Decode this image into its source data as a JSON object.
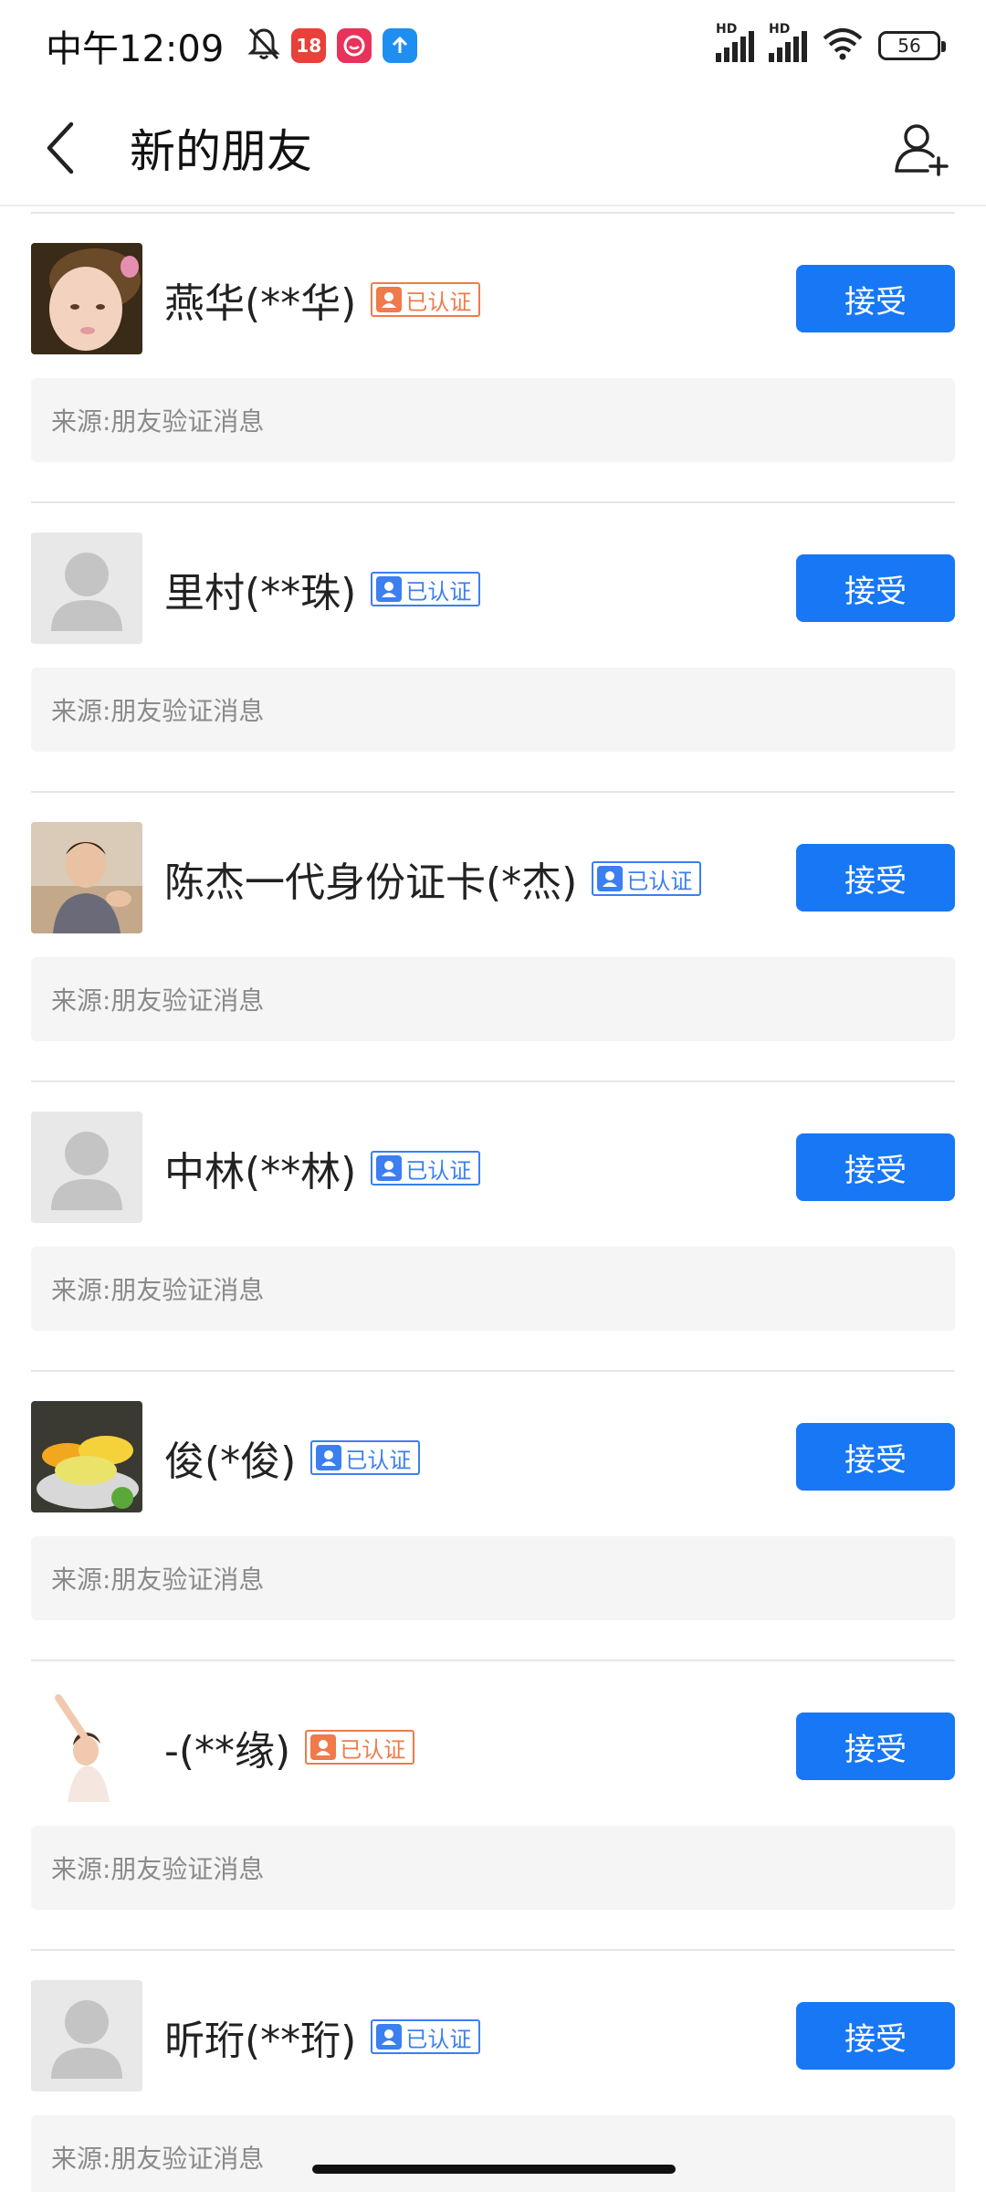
{
  "status_bar": {
    "time": "中午12:09",
    "notif_icons": [
      {
        "icon": "bell-off-icon"
      },
      {
        "icon": "app-icon-red",
        "text": "18",
        "color": "#e8403a"
      },
      {
        "icon": "app-icon-pink",
        "color": "#e8325a"
      },
      {
        "icon": "upload-icon",
        "color": "#1e8ff0"
      }
    ],
    "signal_1_label": "HD",
    "signal_2_label": "HD",
    "battery": "56"
  },
  "nav": {
    "title": "新的朋友",
    "back_icon": "back-chevron-icon",
    "add_icon": "add-friend-icon"
  },
  "colors": {
    "accent": "#1777f5",
    "badge_male": "#3b7ff0",
    "badge_female": "#f07a4a",
    "source_bg": "#f5f5f5"
  },
  "requests": [
    {
      "name": "燕华(**华)",
      "badge": "已认证",
      "badge_type": "female",
      "accept": "接受",
      "source": "来源:朋友验证消息",
      "avatar": "photo-child"
    },
    {
      "name": "里村(**珠)",
      "badge": "已认证",
      "badge_type": "male",
      "accept": "接受",
      "source": "来源:朋友验证消息",
      "avatar": "default"
    },
    {
      "name": "陈杰一代身份证卡(*杰)",
      "badge": "已认证",
      "badge_type": "male",
      "accept": "接受",
      "source": "来源:朋友验证消息",
      "avatar": "photo-man"
    },
    {
      "name": "中林(**林)",
      "badge": "已认证",
      "badge_type": "male",
      "accept": "接受",
      "source": "来源:朋友验证消息",
      "avatar": "default"
    },
    {
      "name": "俊(*俊)",
      "badge": "已认证",
      "badge_type": "male",
      "accept": "接受",
      "source": "来源:朋友验证消息",
      "avatar": "photo-lemon"
    },
    {
      "name": "-(**缘)",
      "badge": "已认证",
      "badge_type": "female",
      "accept": "接受",
      "source": "来源:朋友验证消息",
      "avatar": "photo-dancer"
    },
    {
      "name": "昕珩(**珩)",
      "badge": "已认证",
      "badge_type": "male",
      "accept": "接受",
      "source": "来源:朋友验证消息",
      "avatar": "default"
    }
  ]
}
